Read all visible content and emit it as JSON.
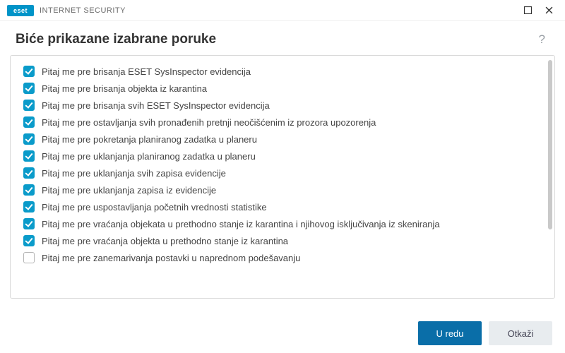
{
  "brand": {
    "logo": "eset",
    "product": "INTERNET SECURITY"
  },
  "header": {
    "title": "Biće prikazane izabrane poruke"
  },
  "items": [
    {
      "checked": true,
      "label": "Pitaj me pre brisanja ESET SysInspector evidencija"
    },
    {
      "checked": true,
      "label": "Pitaj me pre brisanja objekta iz karantina"
    },
    {
      "checked": true,
      "label": "Pitaj me pre brisanja svih ESET SysInspector evidencija"
    },
    {
      "checked": true,
      "label": "Pitaj me pre ostavljanja svih pronađenih pretnji neočišćenim iz prozora upozorenja"
    },
    {
      "checked": true,
      "label": "Pitaj me pre pokretanja planiranog zadatka u planeru"
    },
    {
      "checked": true,
      "label": "Pitaj me pre uklanjanja planiranog zadatka u planeru"
    },
    {
      "checked": true,
      "label": "Pitaj me pre uklanjanja svih zapisa evidencije"
    },
    {
      "checked": true,
      "label": "Pitaj me pre uklanjanja zapisa iz evidencije"
    },
    {
      "checked": true,
      "label": "Pitaj me pre uspostavljanja početnih vrednosti statistike"
    },
    {
      "checked": true,
      "label": "Pitaj me pre vraćanja objekata u prethodno stanje iz karantina i njihovog isključivanja iz skeniranja"
    },
    {
      "checked": true,
      "label": "Pitaj me pre vraćanja objekta u prethodno stanje iz karantina"
    },
    {
      "checked": false,
      "label": "Pitaj me pre zanemarivanja postavki u naprednom podešavanju"
    }
  ],
  "footer": {
    "ok": "U redu",
    "cancel": "Otkaži"
  },
  "help": "?"
}
